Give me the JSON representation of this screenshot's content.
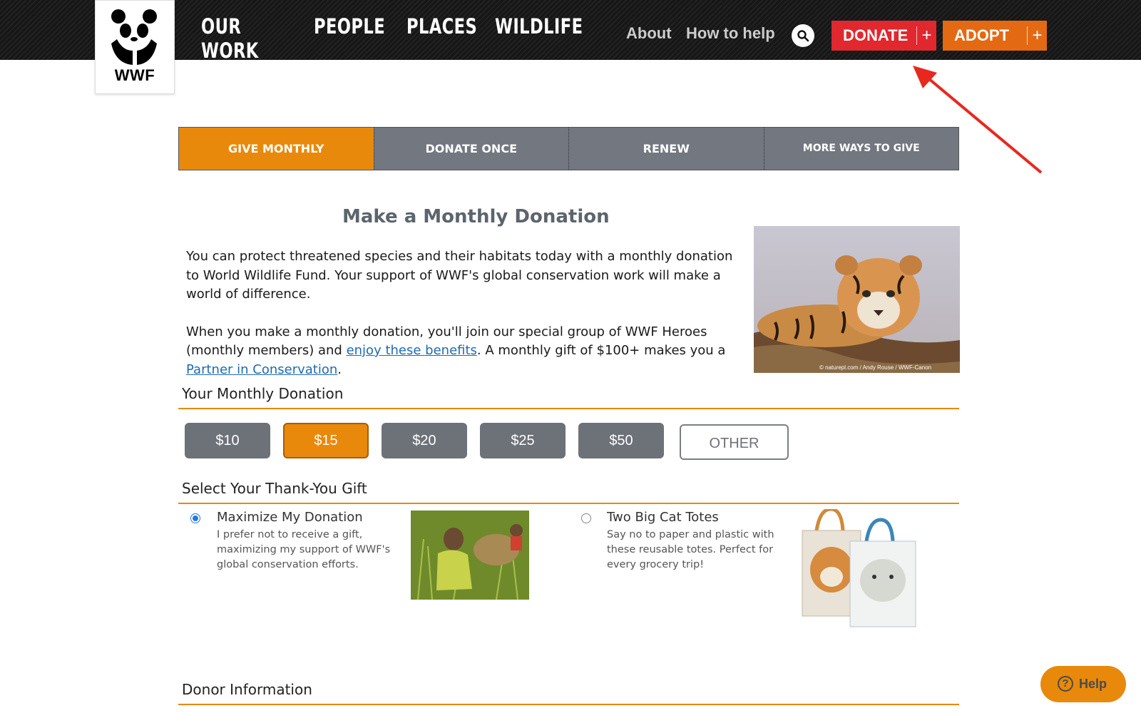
{
  "header": {
    "logo_text": "WWF",
    "main_nav": [
      "OUR WORK",
      "PEOPLE",
      "PLACES",
      "WILDLIFE"
    ],
    "about": "About",
    "how_to_help": "How to help",
    "donate": "DONATE",
    "adopt": "ADOPT",
    "plus": "+"
  },
  "tabs": [
    "GIVE MONTHLY",
    "DONATE ONCE",
    "RENEW",
    "MORE WAYS TO GIVE"
  ],
  "page_title": "Make a Monthly Donation",
  "intro": {
    "p1": "You can protect threatened species and their habitats today with a monthly donation to World Wildlife Fund. Your support of WWF's global conservation work will make a world of difference.",
    "p2_a": "When you make a monthly donation, you'll join our special group of WWF Heroes (monthly members) and ",
    "p2_link1": "enjoy these benefits",
    "p2_b": ". A monthly gift of $100+ makes you a ",
    "p2_link2": "Partner in Conservation",
    "p2_c": "."
  },
  "image_credit": "© naturepl.com / Andy Rouse / WWF-Canon",
  "monthly_donation": {
    "heading": "Your Monthly Donation",
    "amounts": [
      "$10",
      "$15",
      "$20",
      "$25",
      "$50"
    ],
    "selected": "$15",
    "other": "OTHER"
  },
  "gift": {
    "heading": "Select Your Thank-You Gift",
    "options": [
      {
        "title": "Maximize My Donation",
        "desc": "I prefer not to receive a gift, maximizing my support of WWF's global conservation efforts.",
        "selected": true
      },
      {
        "title": "Two Big Cat Totes",
        "desc": "Say no to paper and plastic with these reusable totes. Perfect for every grocery trip!",
        "selected": false
      }
    ]
  },
  "donor_heading": "Donor Information",
  "help": "Help",
  "colors": {
    "accent": "#e8890c",
    "donate_red": "#e0282e",
    "adopt_orange": "#e36a13",
    "tab_gray": "#727780",
    "link": "#1f6bb0"
  }
}
